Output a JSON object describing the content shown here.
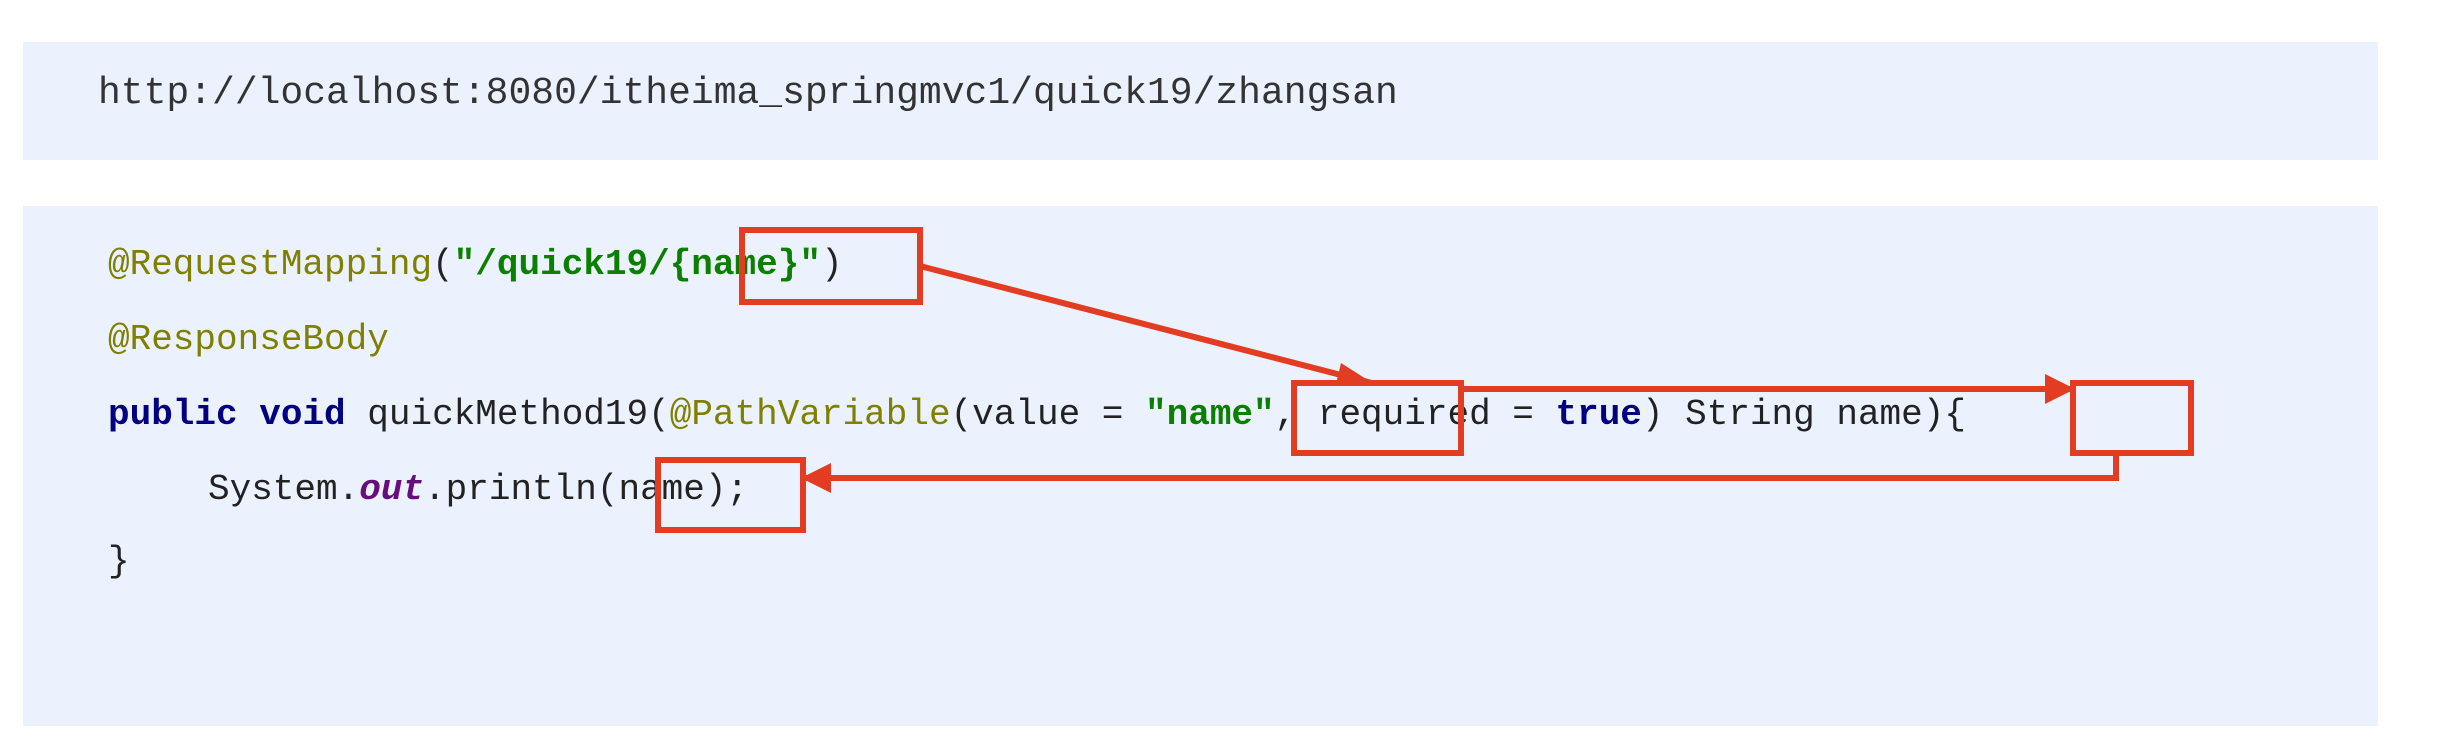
{
  "url_bar": {
    "url": "http://localhost:8080/itheima_springmvc1/quick19/zhangsan"
  },
  "code": {
    "line1": {
      "annotation": "@RequestMapping",
      "open": "(",
      "path_string": "\"/quick19/{name}\"",
      "close": ")"
    },
    "line2": {
      "annotation": "@ResponseBody"
    },
    "line3": {
      "kw_public": "public",
      "kw_void": "void",
      "method": "quickMethod19(",
      "annotation": "@PathVariable",
      "params_open": "(value = ",
      "value_string": "\"name\"",
      "required": ", required = ",
      "kw_true": "true",
      "params_rest": ") String name){"
    },
    "line4": {
      "object": "System.",
      "field": "out",
      "call": ".println(name);"
    },
    "line5": {
      "brace": "}"
    }
  },
  "colors": {
    "panel_bg": "#ebf2fe",
    "annotation": "#808000",
    "string": "#0b8000",
    "keyword": "#000080",
    "static_field": "#660e7a",
    "highlight": "#e23c22"
  }
}
